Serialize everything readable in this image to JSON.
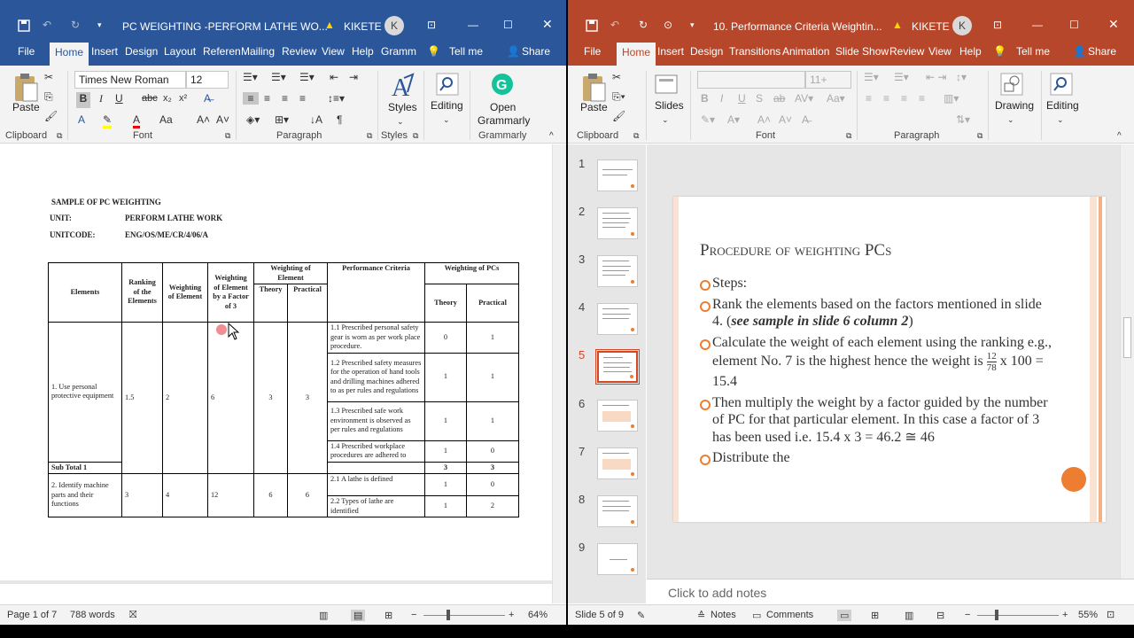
{
  "word": {
    "title": "PC WEIGHTING -PERFORM LATHE WO...",
    "warning_user": "KIKETE",
    "avatar": "K",
    "tabs": [
      "File",
      "Home",
      "Insert",
      "Design",
      "Layout",
      "Referen",
      "Mailing",
      "Review",
      "View",
      "Help",
      "Gramm"
    ],
    "tell_me": "Tell me",
    "share": "Share",
    "font_name": "Times New Roman",
    "font_size": "12",
    "groups": {
      "clipboard": "Clipboard",
      "font": "Font",
      "paragraph": "Paragraph",
      "styles": "Styles",
      "grammarly": "Grammarly"
    },
    "buttons": {
      "paste": "Paste",
      "styles": "Styles",
      "editing": "Editing",
      "open_grammarly_1": "Open",
      "open_grammarly_2": "Grammarly"
    },
    "doc": {
      "heading": "SAMPLE OF PC WEIGHTING",
      "unit_label": "UNIT:",
      "unit_value": "PERFORM LATHE WORK",
      "code_label": "UNITCODE:",
      "code_value": "ENG/OS/ME/CR/4/06/A"
    },
    "table": {
      "h_elements": "Elements",
      "h_ranking": "Ranking of the Elements",
      "h_weighting": "Weighting of Element",
      "h_factor": "Weighting of Element by a Factor of 3",
      "h_weight_el": "Weighting of Element",
      "h_theory": "Theory",
      "h_practical": "Practical",
      "h_pc": "Performance Criteria",
      "h_weight_pcs": "Weighting of PCs",
      "h_theory2": "Theory",
      "h_practical2": "Practical",
      "e1": "1. Use personal protective equipment",
      "e1_rank": "1.5",
      "e1_weight": "2",
      "e1_factor": "6",
      "e1_theory": "3",
      "e1_practical": "3",
      "pc11": "1.1 Prescribed personal safety gear is worn as per work place procedure.",
      "pc11_t": "0",
      "pc11_p": "1",
      "pc12": "1.2 Prescribed safety measures for the operation of hand tools and drilling machines adhered to as per rules and regulations",
      "pc12_t": "1",
      "pc12_p": "1",
      "pc13": "1.3 Prescribed safe work environment is observed as per rules and regulations",
      "pc13_t": "1",
      "pc13_p": "1",
      "pc14": "1.4 Prescribed workplace procedures are adhered to",
      "pc14_t": "1",
      "pc14_p": "0",
      "subtotal": "Sub Total 1",
      "sub_t": "3",
      "sub_p": "3",
      "e2": "2. Identify machine parts and their functions",
      "e2_rank": "3",
      "e2_weight": "4",
      "e2_factor": "12",
      "e2_theory": "6",
      "e2_practical": "6",
      "pc21": "2.1 A lathe is defined",
      "pc21_t": "1",
      "pc21_p": "0",
      "pc22": "2.2 Types of lathe are identified",
      "pc22_t": "1",
      "pc22_p": "2"
    },
    "status": {
      "page": "Page 1 of 7",
      "words": "788 words",
      "zoom": "64%"
    }
  },
  "ppt": {
    "title": "10. Performance Criteria Weightin...",
    "warning_user": "KIKETE",
    "avatar": "K",
    "tabs": [
      "File",
      "Home",
      "Insert",
      "Design",
      "Transitions",
      "Animation",
      "Slide Show",
      "Review",
      "View",
      "Help"
    ],
    "tell_me": "Tell me",
    "share": "Share",
    "font_size": "11+",
    "groups": {
      "clipboard": "Clipboard",
      "font": "Font",
      "paragraph": "Paragraph"
    },
    "buttons": {
      "paste": "Paste",
      "slides": "Slides",
      "drawing": "Drawing",
      "editing": "Editing"
    },
    "thumb_numbers": [
      "1",
      "2",
      "3",
      "4",
      "5",
      "6",
      "7",
      "8",
      "9"
    ],
    "slide": {
      "title": "Procedure of weighting PCs",
      "b1": "Steps:",
      "b2_a": "Rank the elements based on the factors mentioned in slide 4. (",
      "b2_b": "see sample in slide 6 column 2",
      "b2_c": ")",
      "b3_a": "Calculate the weight of each element using the ranking e.g., element No. 7 is the highest hence the weight is ",
      "b3_num": "12",
      "b3_den": "78",
      "b3_b": " x 100 = 15.4",
      "b4": "Then multiply the weight by a factor guided by the number of PC for that particular element. In this case a factor of 3 has been used i.e. 15.4 x 3 = 46.2  ≅ 46",
      "b5": "Distribute the"
    },
    "notes_placeholder": "Click to add notes",
    "status": {
      "slide": "Slide 5 of 9",
      "notes": "Notes",
      "comments": "Comments",
      "zoom": "55%"
    },
    "accent": "#ed7d31"
  },
  "colors": {
    "word_blue": "#2b579a",
    "ppt_red": "#b7472a"
  }
}
